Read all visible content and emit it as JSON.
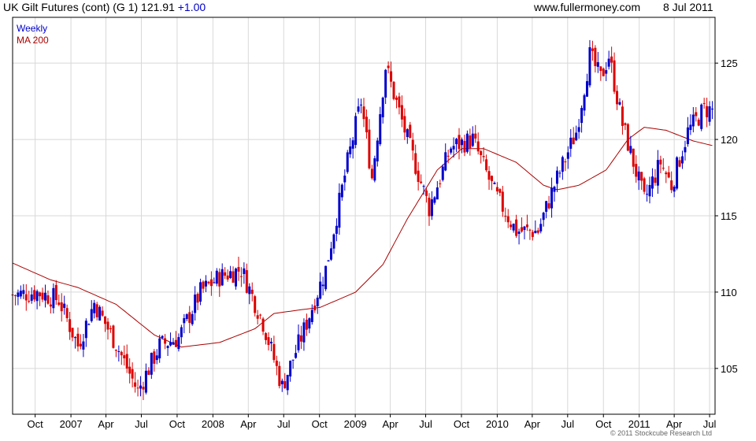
{
  "header": {
    "title": "UK Gilt Futures (cont) (G 1) 121.91",
    "change": "+1.00",
    "source": "www.fullermoney.com",
    "date": "8 Jul 2011"
  },
  "footer": {
    "copyright": "© 2011 Stockcube Research Ltd"
  },
  "colors": {
    "up": "#0000cc",
    "down": "#dd0000",
    "ma": "#aa0000",
    "grid": "#d8d8d8"
  },
  "chart_data": {
    "type": "candlestick",
    "period": "Weekly",
    "legend": [
      "Weekly",
      "MA 200"
    ],
    "x_ticks": [
      "Oct",
      "2007",
      "Apr",
      "Jul",
      "Oct",
      "2008",
      "Apr",
      "Jul",
      "Oct",
      "2009",
      "Apr",
      "Jul",
      "Oct",
      "2010",
      "Apr",
      "Jul",
      "Oct",
      "2011",
      "Apr",
      "Jul"
    ],
    "y_ticks": [
      105,
      110,
      115,
      120,
      125
    ],
    "ylim": [
      102,
      128
    ],
    "x_range": [
      "2006-08-04",
      "2011-07-15"
    ],
    "weekly_close_anchors": [
      {
        "date": "2006-08-04",
        "close": 109.8
      },
      {
        "date": "2006-10-06",
        "close": 110.0
      },
      {
        "date": "2006-12-01",
        "close": 109.5
      },
      {
        "date": "2007-01-19",
        "close": 106.5
      },
      {
        "date": "2007-03-02",
        "close": 109.3
      },
      {
        "date": "2007-04-27",
        "close": 106.6
      },
      {
        "date": "2007-06-22",
        "close": 103.5
      },
      {
        "date": "2007-08-17",
        "close": 106.5
      },
      {
        "date": "2007-10-05",
        "close": 107.0
      },
      {
        "date": "2007-11-30",
        "close": 110.0
      },
      {
        "date": "2008-01-18",
        "close": 111.0
      },
      {
        "date": "2008-03-14",
        "close": 111.5
      },
      {
        "date": "2008-05-09",
        "close": 108.0
      },
      {
        "date": "2008-06-27",
        "close": 103.8
      },
      {
        "date": "2008-08-22",
        "close": 107.5
      },
      {
        "date": "2008-10-17",
        "close": 111.5
      },
      {
        "date": "2008-12-12",
        "close": 118.5
      },
      {
        "date": "2009-01-16",
        "close": 122.5
      },
      {
        "date": "2009-02-13",
        "close": 117.5
      },
      {
        "date": "2009-03-20",
        "close": 124.8
      },
      {
        "date": "2009-05-15",
        "close": 120.0
      },
      {
        "date": "2009-07-10",
        "close": 115.5
      },
      {
        "date": "2009-09-04",
        "close": 119.5
      },
      {
        "date": "2009-10-30",
        "close": 120.0
      },
      {
        "date": "2009-12-25",
        "close": 116.5
      },
      {
        "date": "2010-02-19",
        "close": 114.0
      },
      {
        "date": "2010-04-16",
        "close": 114.0
      },
      {
        "date": "2010-05-28",
        "close": 117.0
      },
      {
        "date": "2010-07-23",
        "close": 120.5
      },
      {
        "date": "2010-08-27",
        "close": 125.5
      },
      {
        "date": "2010-09-24",
        "close": 124.0
      },
      {
        "date": "2010-10-15",
        "close": 125.5
      },
      {
        "date": "2010-11-19",
        "close": 121.0
      },
      {
        "date": "2011-01-14",
        "close": 116.0
      },
      {
        "date": "2011-02-25",
        "close": 118.5
      },
      {
        "date": "2011-03-25",
        "close": 117.0
      },
      {
        "date": "2011-05-06",
        "close": 120.5
      },
      {
        "date": "2011-06-17",
        "close": 122.0
      },
      {
        "date": "2011-07-08",
        "close": 121.91
      }
    ],
    "ma200_anchors": [
      {
        "date": "2006-08-04",
        "value": 111.9
      },
      {
        "date": "2006-11-10",
        "value": 110.8
      },
      {
        "date": "2007-01-19",
        "value": 110.3
      },
      {
        "date": "2007-04-27",
        "value": 109.2
      },
      {
        "date": "2007-08-03",
        "value": 107.2
      },
      {
        "date": "2007-10-12",
        "value": 106.4
      },
      {
        "date": "2008-01-18",
        "value": 106.7
      },
      {
        "date": "2008-04-18",
        "value": 107.6
      },
      {
        "date": "2008-06-06",
        "value": 108.6
      },
      {
        "date": "2008-08-01",
        "value": 108.8
      },
      {
        "date": "2008-10-03",
        "value": 109.0
      },
      {
        "date": "2009-01-02",
        "value": 110.0
      },
      {
        "date": "2009-03-13",
        "value": 111.8
      },
      {
        "date": "2009-05-15",
        "value": 114.8
      },
      {
        "date": "2009-07-31",
        "value": 118.0
      },
      {
        "date": "2009-10-02",
        "value": 119.4
      },
      {
        "date": "2009-11-27",
        "value": 119.4
      },
      {
        "date": "2010-02-19",
        "value": 118.5
      },
      {
        "date": "2010-04-30",
        "value": 117.0
      },
      {
        "date": "2010-06-04",
        "value": 116.7
      },
      {
        "date": "2010-07-30",
        "value": 117.0
      },
      {
        "date": "2010-10-08",
        "value": 118.0
      },
      {
        "date": "2010-12-03",
        "value": 120.0
      },
      {
        "date": "2011-01-14",
        "value": 120.8
      },
      {
        "date": "2011-03-11",
        "value": 120.6
      },
      {
        "date": "2011-05-20",
        "value": 119.9
      },
      {
        "date": "2011-07-08",
        "value": 119.6
      }
    ]
  }
}
